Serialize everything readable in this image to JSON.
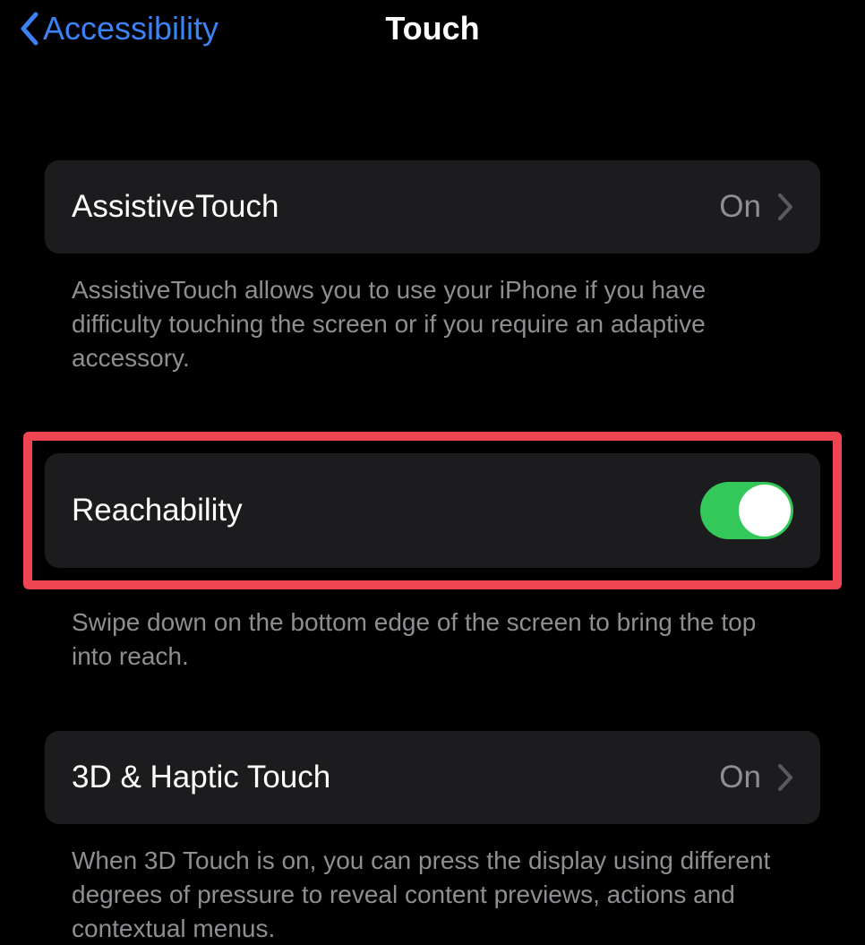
{
  "header": {
    "back_label": "Accessibility",
    "title": "Touch"
  },
  "sections": {
    "assistive_touch": {
      "label": "AssistiveTouch",
      "value": "On",
      "description": "AssistiveTouch allows you to use your iPhone if you have difficulty touching the screen or if you require an adaptive accessory."
    },
    "reachability": {
      "label": "Reachability",
      "enabled": true,
      "description": "Swipe down on the bottom edge of the screen to bring the top into reach."
    },
    "haptic_touch": {
      "label": "3D & Haptic Touch",
      "value": "On",
      "description": "When 3D Touch is on, you can press the display using different degrees of pressure to reveal content previews, actions and contextual menus."
    }
  }
}
